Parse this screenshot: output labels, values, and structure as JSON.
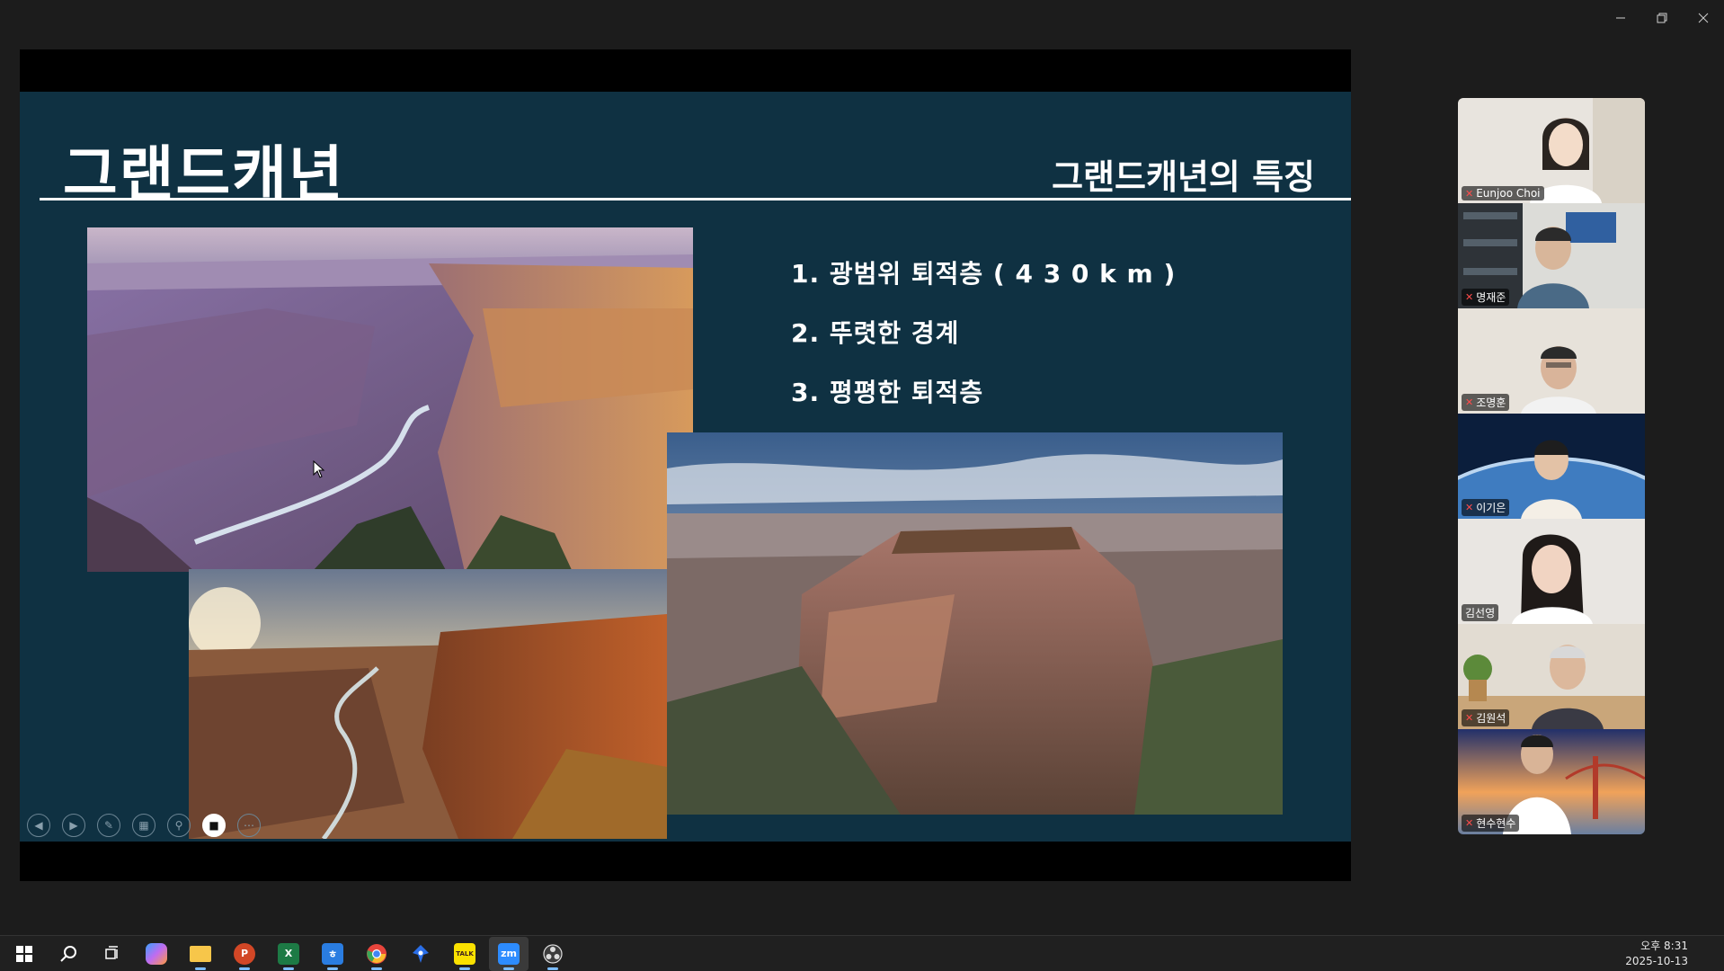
{
  "window": {
    "controls": [
      "minimize",
      "restore",
      "close"
    ]
  },
  "slide": {
    "title": "그랜드캐년",
    "subtitle": "그랜드캐년의 특징",
    "features": [
      "1.  광범위 퇴적층 ( 4 3 0 k m )",
      "2.  뚜렷한 경계",
      "3.  평평한 퇴적층"
    ],
    "toolbar": [
      {
        "name": "previous-slide-icon",
        "glyph": "◀"
      },
      {
        "name": "next-slide-icon",
        "glyph": "▶"
      },
      {
        "name": "pen-icon",
        "glyph": "✎"
      },
      {
        "name": "all-slides-icon",
        "glyph": "▦"
      },
      {
        "name": "zoom-icon",
        "glyph": "⚲"
      },
      {
        "name": "camera-icon",
        "glyph": "■"
      },
      {
        "name": "more-options-icon",
        "glyph": "⋯"
      }
    ]
  },
  "participants": [
    {
      "name": "Eunjoo Choi",
      "muted": true,
      "speaking": false
    },
    {
      "name": "명재준",
      "muted": true,
      "speaking": false
    },
    {
      "name": "조명훈",
      "muted": true,
      "speaking": false
    },
    {
      "name": "이기은",
      "muted": true,
      "speaking": false
    },
    {
      "name": "김선영",
      "muted": false,
      "speaking": true
    },
    {
      "name": "김원석",
      "muted": true,
      "speaking": false
    },
    {
      "name": "현수현수",
      "muted": true,
      "speaking": false
    }
  ],
  "taskbar": {
    "apps": [
      {
        "name": "start-button",
        "label": "",
        "color": "#ffffff"
      },
      {
        "name": "search-button",
        "label": "",
        "color": "#ffffff"
      },
      {
        "name": "task-view-button",
        "label": "",
        "color": "#ffffff"
      },
      {
        "name": "copilot-app",
        "label": "",
        "color": "#c06cf0"
      },
      {
        "name": "file-explorer-app",
        "label": "",
        "color": "#f7c64a"
      },
      {
        "name": "powerpoint-app",
        "label": "P",
        "color": "#d24726"
      },
      {
        "name": "excel-app",
        "label": "X",
        "color": "#1d7a45"
      },
      {
        "name": "hangul-app",
        "label": "ㅎ",
        "color": "#2a7de1"
      },
      {
        "name": "chrome-app",
        "label": "",
        "color": "#e8453c"
      },
      {
        "name": "pin-app",
        "label": "",
        "color": "#2b6fe8"
      },
      {
        "name": "kakaotalk-app",
        "label": "TALK",
        "color": "#fae100"
      },
      {
        "name": "zoom-app",
        "label": "zm",
        "color": "#2d8cff"
      },
      {
        "name": "obs-app",
        "label": "",
        "color": "#3c3c3c"
      }
    ],
    "clock": {
      "time": "오후 8:31",
      "date": "2025-10-13"
    }
  }
}
